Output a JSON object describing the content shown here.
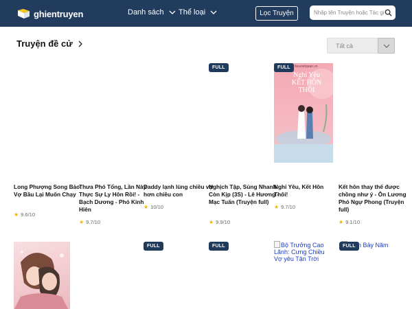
{
  "header": {
    "logo_text": "ghientruyen",
    "nav": [
      {
        "label": "Danh sách"
      },
      {
        "label": "Thể loại"
      }
    ],
    "filter_label": "Lọc Truyện",
    "search_placeholder": "Nhập tên Truyện hoặc Tác giả"
  },
  "section": {
    "title": "Truyện đề cử",
    "select_value": "Tất cả"
  },
  "books_row1": [
    {
      "title": "Long Phượng Song Bảo: Vợ Bầu Lại Muốn Chạy",
      "rating": "9.6/10",
      "full": false
    },
    {
      "title": "Thưa Phó Tổng, Lần Này Thực Sự Ly Hôn Rồi! - Bạch Dương - Phó Kinh Hiên",
      "rating": "9.7/10",
      "full": false
    },
    {
      "title": "Daddy lạnh lùng chiều vợ hơn chiều con",
      "rating": "10/10",
      "full": false
    },
    {
      "title": "Nghịch Tập, Sủng Nhanh Còn Kịp (3S) - Lê Hương - Mạc Tuấn (Truyện full)",
      "rating": "9.9/10",
      "full": true,
      "badge": "FULL"
    },
    {
      "title": "Nghỉ Yêu, Kết Hôn Thôi!",
      "rating": "9.7/10",
      "full": true,
      "badge": "FULL",
      "cover_text": "Nghỉ Yêu KẾT HÔN THÔI",
      "cover_small": "tieuvietquan.vn"
    },
    {
      "title": "Kết hôn thay thế được chồng như ý - Ôn Lương Phó Ngự Phong (Truyện full)",
      "rating": "9.1/10",
      "full": false
    }
  ],
  "books_row2": [
    {
      "badge": ""
    },
    {
      "badge": ""
    },
    {
      "badge": "FULL"
    },
    {
      "badge": "FULL"
    },
    {
      "alt": "Bộ Trưởng Cao Lãnh: Cưng Chiều Vợ yêu Tận Trời"
    },
    {
      "badge": "FULL",
      "alt": "Đêm Bảy Năm"
    }
  ],
  "colors": {
    "header_bg": "#213c5c",
    "badge_bg": "#1f3a5a",
    "star": "#f0b400",
    "link_alt": "#1a3cc8"
  }
}
